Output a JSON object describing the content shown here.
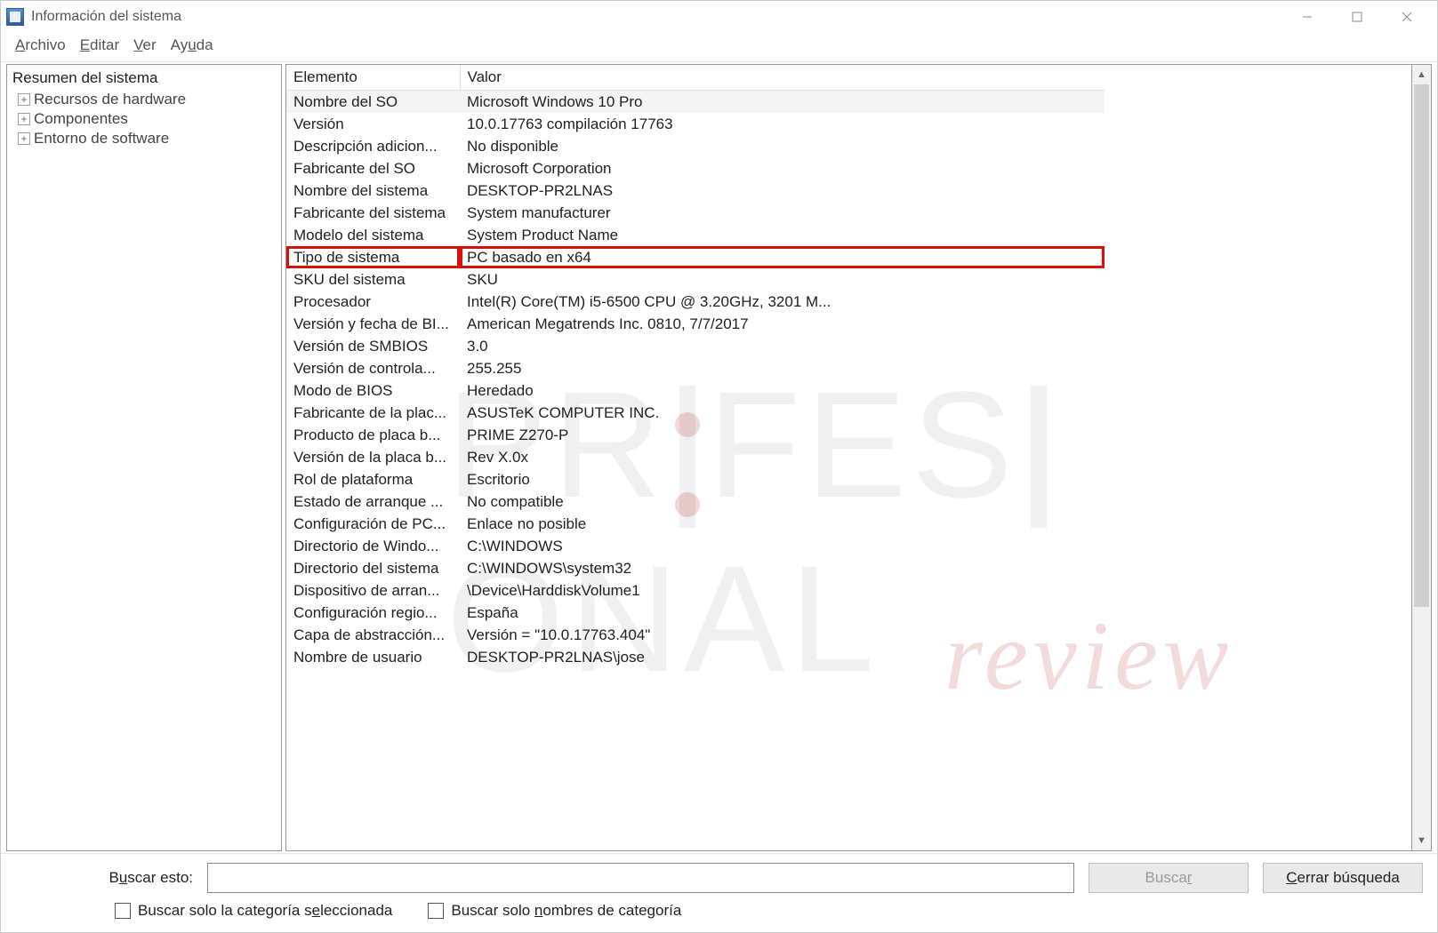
{
  "window": {
    "title": "Información del sistema"
  },
  "menu": {
    "archivo": "Archivo",
    "editar": "Editar",
    "ver": "Ver",
    "ayuda": "Ayuda"
  },
  "tree": {
    "root": "Resumen del sistema",
    "nodes": [
      {
        "label": "Recursos de hardware"
      },
      {
        "label": "Componentes"
      },
      {
        "label": "Entorno de software"
      }
    ]
  },
  "columns": {
    "element": "Elemento",
    "value": "Valor"
  },
  "rows": [
    {
      "name": "Nombre del SO",
      "value": "Microsoft Windows 10 Pro",
      "alt": true
    },
    {
      "name": "Versión",
      "value": "10.0.17763 compilación 17763"
    },
    {
      "name": "Descripción adicion...",
      "value": "No disponible"
    },
    {
      "name": "Fabricante del SO",
      "value": "Microsoft Corporation"
    },
    {
      "name": "Nombre del sistema",
      "value": "DESKTOP-PR2LNAS"
    },
    {
      "name": "Fabricante del sistema",
      "value": "System manufacturer"
    },
    {
      "name": "Modelo del sistema",
      "value": "System Product Name"
    },
    {
      "name": "Tipo de sistema",
      "value": "PC basado en x64",
      "highlight": true
    },
    {
      "name": "SKU del sistema",
      "value": "SKU"
    },
    {
      "name": "Procesador",
      "value": "Intel(R) Core(TM) i5-6500 CPU @ 3.20GHz, 3201 M..."
    },
    {
      "name": "Versión y fecha de BI...",
      "value": "American Megatrends Inc. 0810, 7/7/2017"
    },
    {
      "name": "Versión de SMBIOS",
      "value": "3.0"
    },
    {
      "name": "Versión de controla...",
      "value": "255.255"
    },
    {
      "name": "Modo de BIOS",
      "value": "Heredado"
    },
    {
      "name": "Fabricante de la plac...",
      "value": "ASUSTeK COMPUTER INC."
    },
    {
      "name": "Producto de placa b...",
      "value": "PRIME Z270-P"
    },
    {
      "name": "Versión de la placa b...",
      "value": "Rev X.0x"
    },
    {
      "name": "Rol de plataforma",
      "value": "Escritorio"
    },
    {
      "name": "Estado de arranque ...",
      "value": "No compatible"
    },
    {
      "name": "Configuración de PC...",
      "value": "Enlace no posible"
    },
    {
      "name": "Directorio de Windo...",
      "value": "C:\\WINDOWS"
    },
    {
      "name": "Directorio del sistema",
      "value": "C:\\WINDOWS\\system32"
    },
    {
      "name": "Dispositivo de arran...",
      "value": "\\Device\\HarddiskVolume1"
    },
    {
      "name": "Configuración regio...",
      "value": "España"
    },
    {
      "name": "Capa de abstracción...",
      "value": "Versión = \"10.0.17763.404\""
    },
    {
      "name": "Nombre de usuario",
      "value": "DESKTOP-PR2LNAS\\jose"
    }
  ],
  "search": {
    "label_pre": "B",
    "label_ul": "u",
    "label_post": "scar esto:",
    "placeholder": "",
    "btn_search_pre": "Busca",
    "btn_search_ul": "r",
    "btn_search_post": "",
    "btn_close_ul": "C",
    "btn_close_post": "errar búsqueda",
    "chk1_pre": "Buscar solo la categoría s",
    "chk1_ul": "e",
    "chk1_post": "leccionada",
    "chk2_pre": "Buscar solo ",
    "chk2_ul": "n",
    "chk2_post": "ombres de categoría"
  },
  "watermark": {
    "left": "PR",
    "mid": "FES",
    "right": "ONAL",
    "sub": "review"
  }
}
